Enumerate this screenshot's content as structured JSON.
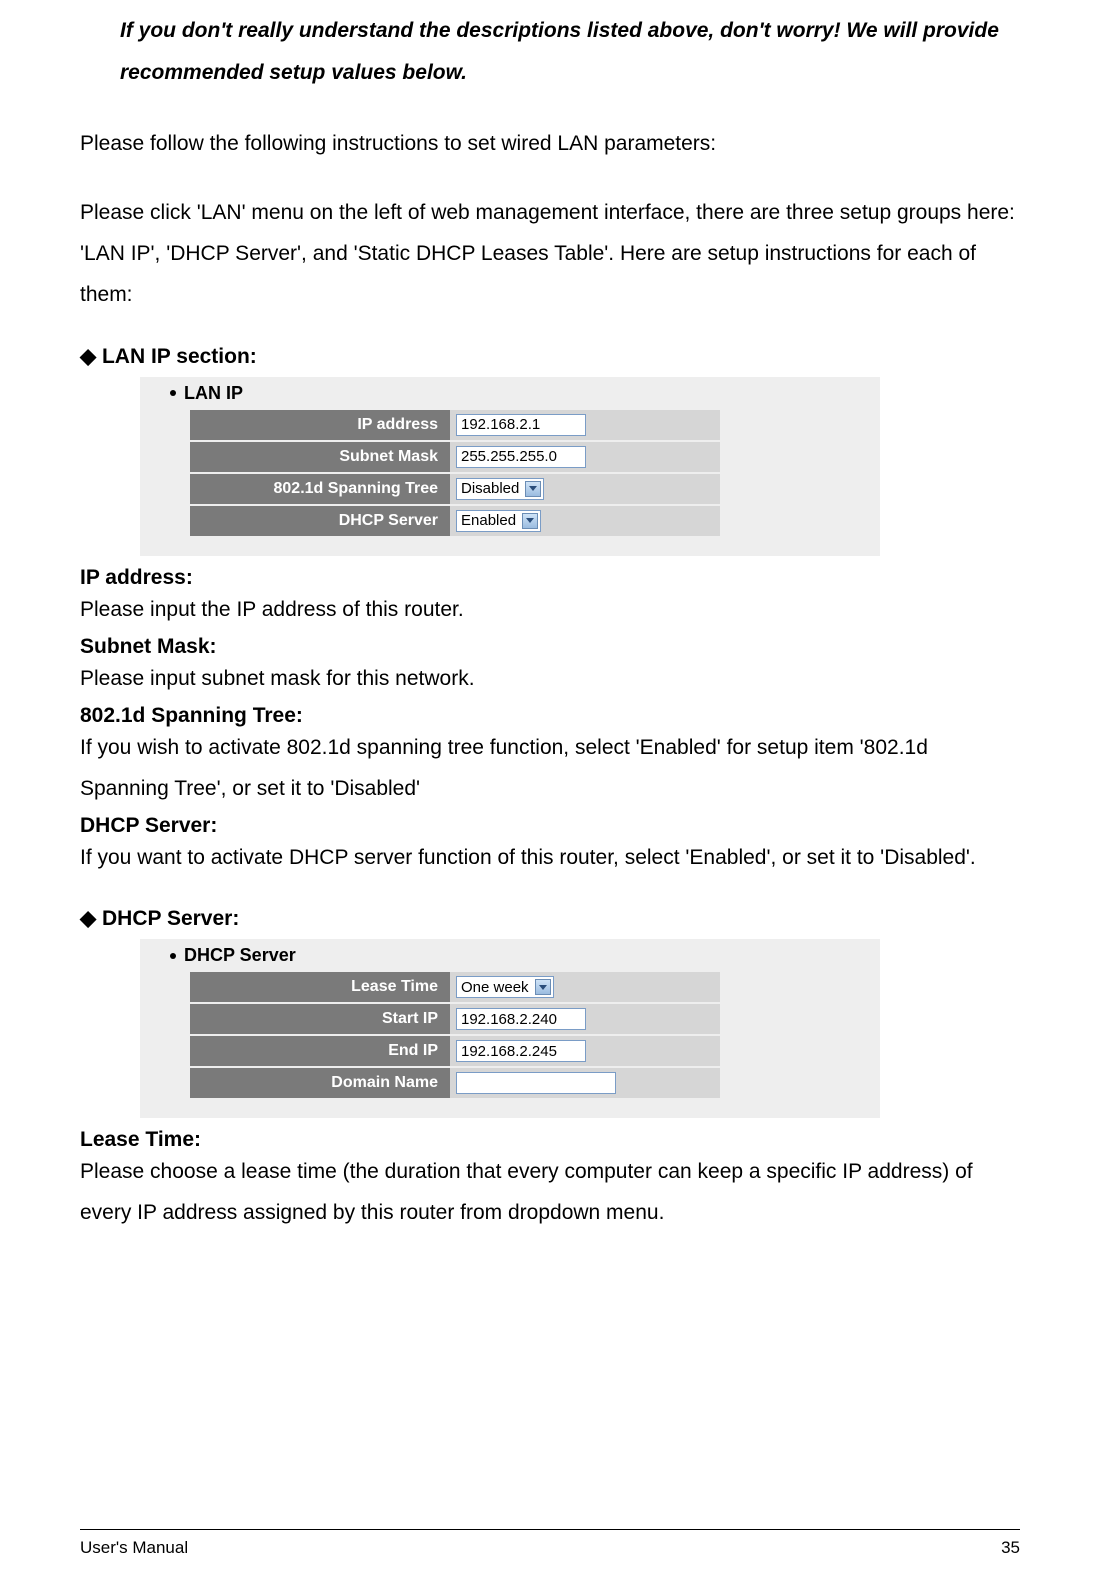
{
  "intro": {
    "italic_note": "If you don't really understand the descriptions listed above, don't worry! We will provide recommended setup values below.",
    "p1": "Please follow the following instructions to set wired LAN parameters:",
    "p2": "Please click 'LAN' menu on the left of web management interface, there are three setup groups here: 'LAN IP', 'DHCP Server', and 'Static DHCP Leases Table'. Here are setup instructions for each of them:"
  },
  "lan_ip": {
    "heading": "LAN IP section:",
    "ss_title": "LAN IP",
    "rows": {
      "ip_label": "IP address",
      "ip_value": "192.168.2.1",
      "subnet_label": "Subnet Mask",
      "subnet_value": "255.255.255.0",
      "spanning_label": "802.1d Spanning Tree",
      "spanning_value": "Disabled",
      "dhcp_label": "DHCP Server",
      "dhcp_value": "Enabled"
    },
    "desc": {
      "ip_h": "IP address:",
      "ip_t": "Please input the IP address of this router.",
      "subnet_h": "Subnet Mask:",
      "subnet_t": "Please input subnet mask for this network.",
      "spanning_h": "802.1d Spanning Tree:",
      "spanning_t": "If you wish to activate 802.1d spanning tree function, select 'Enabled' for setup item '802.1d Spanning Tree', or set it to 'Disabled'",
      "dhcp_h": "DHCP Server:",
      "dhcp_t": "If you want to activate DHCP server function of this router, select 'Enabled', or set it to 'Disabled'."
    }
  },
  "dhcp_server": {
    "heading": "DHCP Server:",
    "ss_title": "DHCP Server",
    "rows": {
      "lease_label": "Lease Time",
      "lease_value": "One week",
      "start_label": "Start IP",
      "start_value": "192.168.2.240",
      "end_label": "End IP",
      "end_value": "192.168.2.245",
      "domain_label": "Domain Name",
      "domain_value": ""
    },
    "desc": {
      "lease_h": "Lease Time:",
      "lease_t": "Please choose a lease time (the duration that every computer can keep a specific IP address) of every IP address assigned by this router from dropdown menu."
    }
  },
  "footer": {
    "left": "User's Manual",
    "right": "35"
  }
}
